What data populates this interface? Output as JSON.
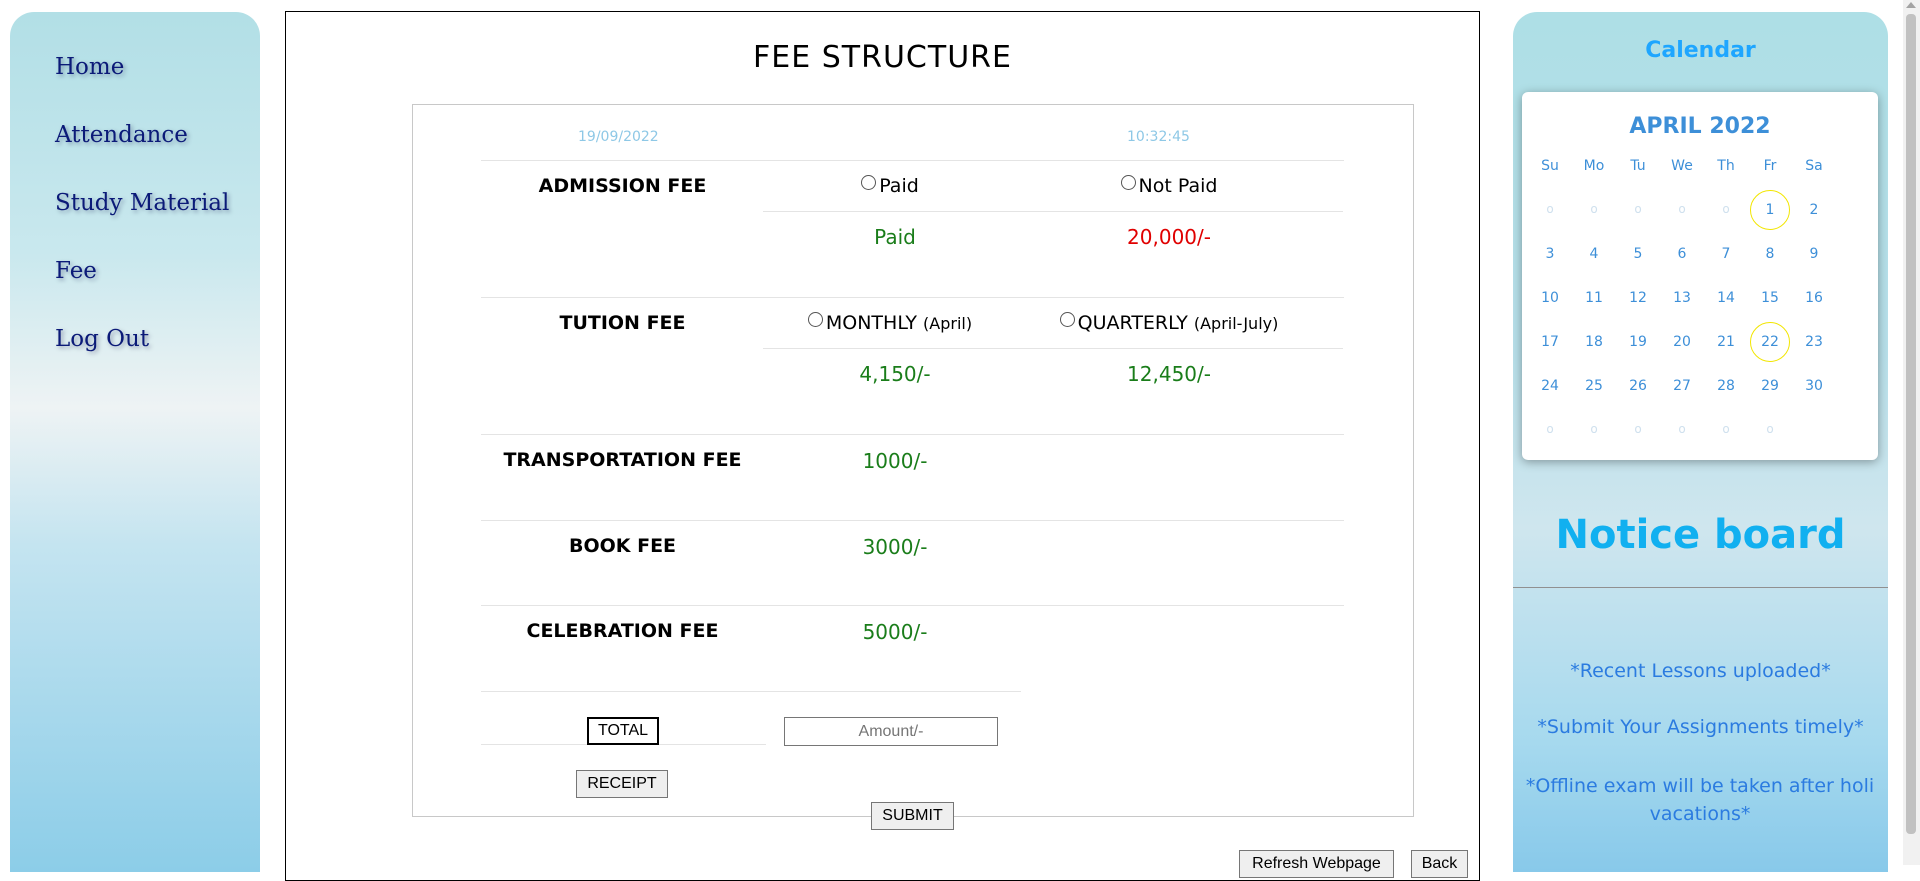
{
  "nav": {
    "items": [
      "Home",
      "Attendance",
      "Study Material",
      "Fee",
      "Log Out"
    ]
  },
  "main": {
    "title": "FEE STRUCTURE",
    "date": "19/09/2022",
    "time": "10:32:45",
    "admission": {
      "label": "ADMISSION FEE",
      "opt_paid": "Paid",
      "opt_not_paid": "Not Paid",
      "status_paid": "Paid",
      "status_amount": "20,000/-"
    },
    "tuition": {
      "label": "TUTION FEE",
      "opt_monthly": "MONTHLY",
      "monthly_note": "(April)",
      "opt_quarterly": "QUARTERLY",
      "quarterly_note": "(April-July)",
      "monthly_amount": "4,150/-",
      "quarterly_amount": "12,450/-"
    },
    "transport": {
      "label": "TRANSPORTATION FEE",
      "amount": "1000/-"
    },
    "book": {
      "label": "BOOK FEE",
      "amount": "3000/-"
    },
    "celebration": {
      "label": "CELEBRATION FEE",
      "amount": "5000/-"
    },
    "total_label": "TOTAL",
    "amount_placeholder": "Amount/-",
    "receipt_label": "RECEIPT",
    "submit_label": "SUBMIT",
    "refresh_label": "Refresh Webpage",
    "back_label": "Back"
  },
  "calendar": {
    "title": "Calendar",
    "month": "APRIL 2022",
    "days_of_week": [
      "Su",
      "Mo",
      "Tu",
      "We",
      "Th",
      "Fr",
      "Sa"
    ],
    "weeks": [
      [
        "o",
        "o",
        "o",
        "o",
        "o",
        "1",
        "2"
      ],
      [
        "3",
        "4",
        "5",
        "6",
        "7",
        "8",
        "9"
      ],
      [
        "10",
        "11",
        "12",
        "13",
        "14",
        "15",
        "16"
      ],
      [
        "17",
        "18",
        "19",
        "20",
        "21",
        "22",
        "23"
      ],
      [
        "24",
        "25",
        "26",
        "27",
        "28",
        "29",
        "30"
      ],
      [
        "o",
        "o",
        "o",
        "o",
        "o",
        "o",
        ""
      ]
    ],
    "highlighted": [
      "1",
      "22"
    ]
  },
  "notice": {
    "title": "Notice board",
    "items": [
      "*Recent Lessons uploaded*",
      "*Submit Your Assignments timely*",
      "*Offline exam will be taken after holi vacations*"
    ]
  },
  "colors": {
    "nav_text": "#0b1a78",
    "amount_green": "#1a7d1a",
    "amount_red": "#e00000",
    "calendar_accent": "#3d8fd8",
    "notice_title": "#11b0f0"
  }
}
